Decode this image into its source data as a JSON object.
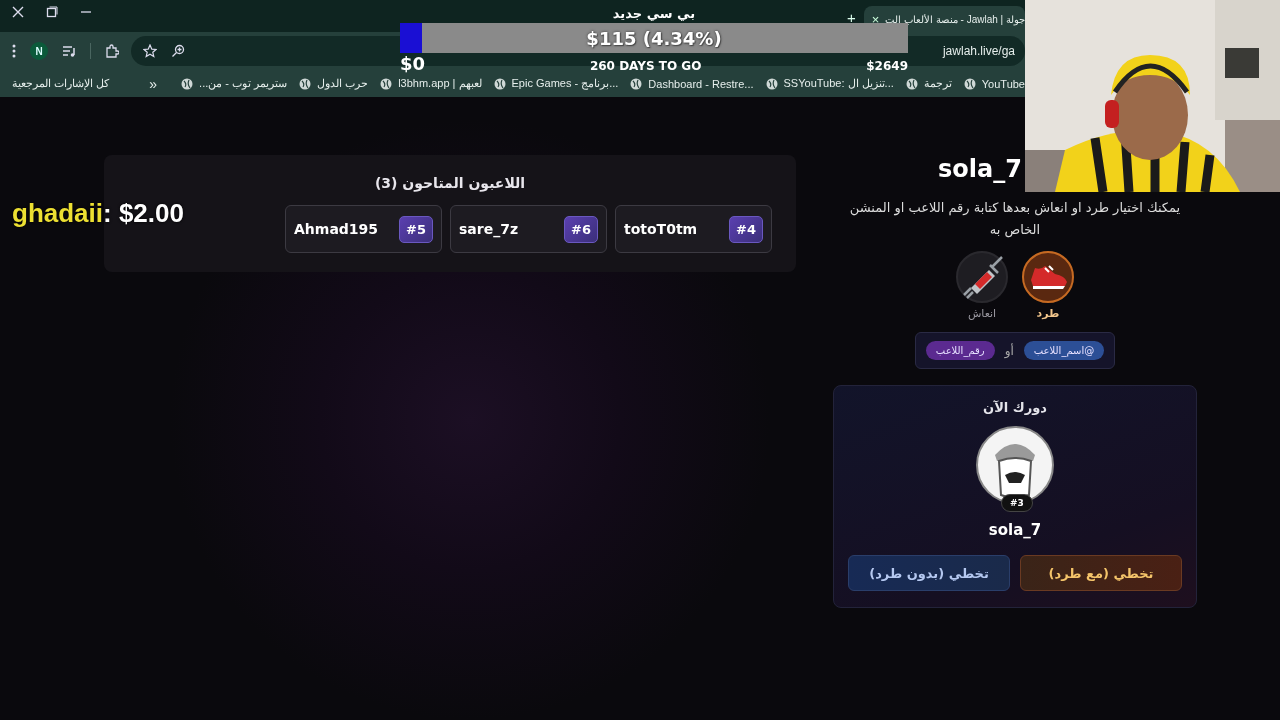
{
  "browser": {
    "tab": {
      "title": "جولة | Jawlah - منصة الألعاب الت",
      "close": "×"
    },
    "new_tab": "+",
    "profile": "N",
    "url": "jawlah.live/ga",
    "bookmarks": [
      {
        "label": "YouTube"
      },
      {
        "label": "ترجمة"
      },
      {
        "label": "SSYouTube: تنزيل ال..."
      },
      {
        "label": "Dashboard - Restre..."
      },
      {
        "label": "Epic Games - برنامج..."
      },
      {
        "label": "l3bhm.app | لعبهم"
      },
      {
        "label": "حرب الدول"
      },
      {
        "label": "ستريمر توب - من..."
      }
    ],
    "bookmarks_more": "»",
    "all_bookmarks": "كل الإشارات المرجعية"
  },
  "goal": {
    "title": "بي سي جديد",
    "level": 0.0434,
    "amount": "$115 (4.34%)",
    "start": "$0",
    "days_left": "260 DAYS TO GO",
    "target": "$2649"
  },
  "donation": {
    "name": "ghadaii",
    "amount": ": $2.00"
  },
  "players_panel": {
    "title": "اللاعبون المتاحون (3)",
    "players": [
      {
        "name": "totoT0tm",
        "number": "#4"
      },
      {
        "name": "sare_7z",
        "number": "#6"
      },
      {
        "name": "Ahmad195",
        "number": "#5"
      }
    ]
  },
  "turn_panel": {
    "player": "sola_7",
    "instructions": "يمكنك اختيار طرد او انعاش بعدها كتابة رقم اللاعب او المنشن الخاص به",
    "actions": [
      {
        "kind": "kick",
        "label": "طرد",
        "selected": true
      },
      {
        "kind": "revive",
        "label": "انعاش",
        "selected": false
      }
    ],
    "hint": {
      "chips": [
        {
          "label": "@اسم_اللاعب",
          "color": "#2c4f96"
        },
        {
          "label": "رقم_اللاعب",
          "color": "#5b2a90"
        }
      ],
      "separator": "أو"
    },
    "current": {
      "title": "دورك الآن",
      "badge": "#3",
      "name": "sola_7",
      "buttons": [
        {
          "kind": "warm",
          "label": "تخطي (مع طرد)"
        },
        {
          "kind": "cool",
          "label": "تخطي (بدون طرد)"
        }
      ]
    }
  }
}
